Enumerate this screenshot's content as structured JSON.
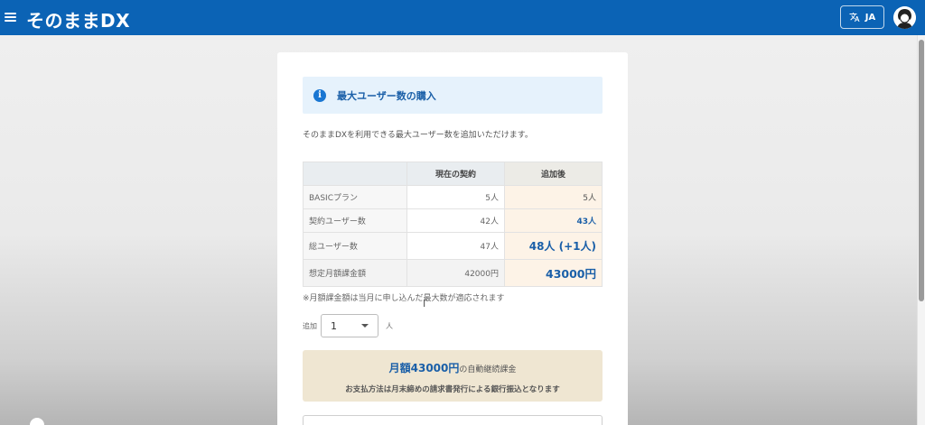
{
  "header": {
    "app_title": "そのままDX",
    "menu_icon": "hamburger-menu-icon",
    "lang_label": "JA",
    "lang_icon": "translate-icon",
    "avatar_icon": "user-avatar-icon",
    "brand_color": "#0b63b5"
  },
  "purchase": {
    "title": "最大ユーザー数の購入",
    "info_icon": "info-icon",
    "description": "そのままDXを利用できる最大ユーザー数を追加いただけます。",
    "table": {
      "headers": [
        "",
        "現在の契約",
        "追加後"
      ],
      "rows": [
        {
          "label": "BASICプラン",
          "current": "5人",
          "after": "5人"
        },
        {
          "label": "契約ユーザー数",
          "current": "42人",
          "after": "43人"
        },
        {
          "label": "総ユーザー数",
          "current": "47人",
          "after": "48人 (+1人)"
        },
        {
          "label": "想定月額課金額",
          "current": "42000円",
          "after": "43000円"
        }
      ]
    },
    "note": "※月額課金額は当月に申し込んだ最大数が適応されます",
    "quantity": {
      "label": "追加",
      "value": "1",
      "unit": "人"
    },
    "charge": {
      "prefix": "月額",
      "amount": "43000円",
      "suffix": "の自動継続課金",
      "payment_note": "お支払方法は月末締めの請求書発行による銀行振込となります"
    }
  }
}
